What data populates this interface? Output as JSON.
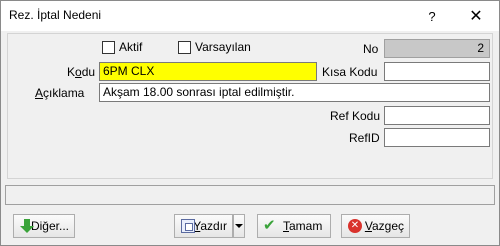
{
  "window": {
    "title": "Rez. İptal Nedeni",
    "help_glyph": "?",
    "close_glyph": "✕"
  },
  "form": {
    "aktif_label": "Aktif",
    "varsayilan_label": "Varsayılan",
    "no_label": "No",
    "no_value": "2",
    "kodu_label_pre": "K",
    "kodu_label_ul": "o",
    "kodu_label_post": "du",
    "kodu_value": "6PM CLX",
    "kisa_kodu_label": "Kısa Kodu",
    "kisa_kodu_value": "",
    "aciklama_label_ul": "A",
    "aciklama_label_post": "çıklama",
    "aciklama_value": "Akşam 18.00 sonrası iptal edilmiştir.",
    "ref_kodu_label": "Ref Kodu",
    "ref_kodu_value": "",
    "refid_label": "RefID",
    "refid_value": ""
  },
  "buttons": {
    "diger_pre": "Di",
    "diger_ul": "ğ",
    "diger_post": "er...",
    "yazdir_ul": "Y",
    "yazdir_post": "azdır",
    "tamam_ul": "T",
    "tamam_post": "amam",
    "vazgec_ul": "V",
    "vazgec_post": "azgeç"
  },
  "icons": {
    "diger": "green-down-arrow-icon",
    "yazdir": "print-preview-icon",
    "tamam": "check-icon",
    "vazgec": "cancel-icon"
  }
}
